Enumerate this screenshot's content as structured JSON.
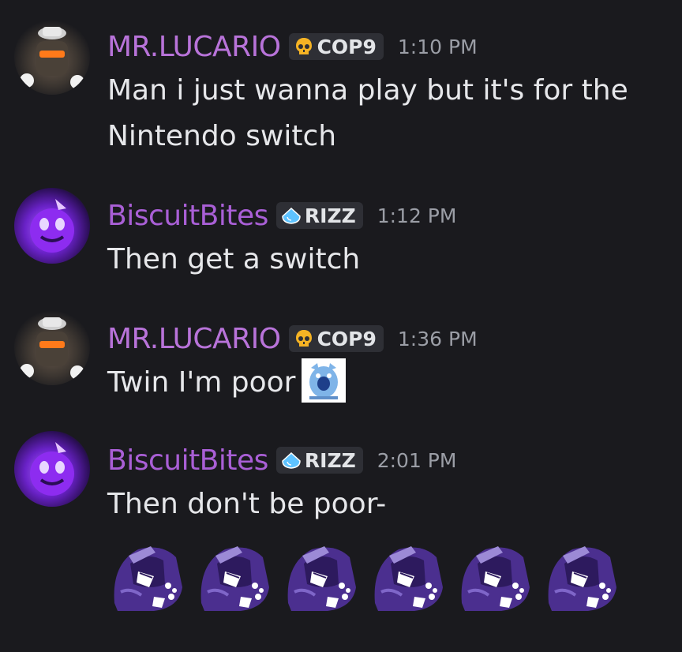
{
  "messages": [
    {
      "author": "MR.LUCARIO",
      "tag": "COP9",
      "tag_icon": "skull-icon",
      "time": "1:10 PM",
      "lines": [
        "Man i just wanna play but it's for the",
        "Nintendo switch"
      ]
    },
    {
      "author": "BiscuitBites",
      "tag": "RIZZ",
      "tag_icon": "water-drop-icon",
      "time": "1:12 PM",
      "lines": [
        "Then get a switch"
      ]
    },
    {
      "author": "MR.LUCARIO",
      "tag": "COP9",
      "tag_icon": "skull-icon",
      "time": "1:36 PM",
      "lines": [
        "Twin I'm poor"
      ],
      "inline_emoji": "crying-creature-emoji"
    },
    {
      "author": "BiscuitBites",
      "tag": "RIZZ",
      "tag_icon": "water-drop-icon",
      "time": "2:01 PM",
      "lines": [
        "Then don't be poor-"
      ],
      "stickers": [
        "purple-character-sticker",
        "purple-character-sticker",
        "purple-character-sticker",
        "purple-character-sticker",
        "purple-character-sticker",
        "purple-character-sticker"
      ]
    }
  ],
  "colors": {
    "background": "#1a1a1e",
    "lucario_name": "#b873d9",
    "biscuit_name": "#a95fd6",
    "tag_bg": "#2e2f35",
    "timestamp": "#9b9ea6",
    "message_text": "#e6e7ea"
  }
}
